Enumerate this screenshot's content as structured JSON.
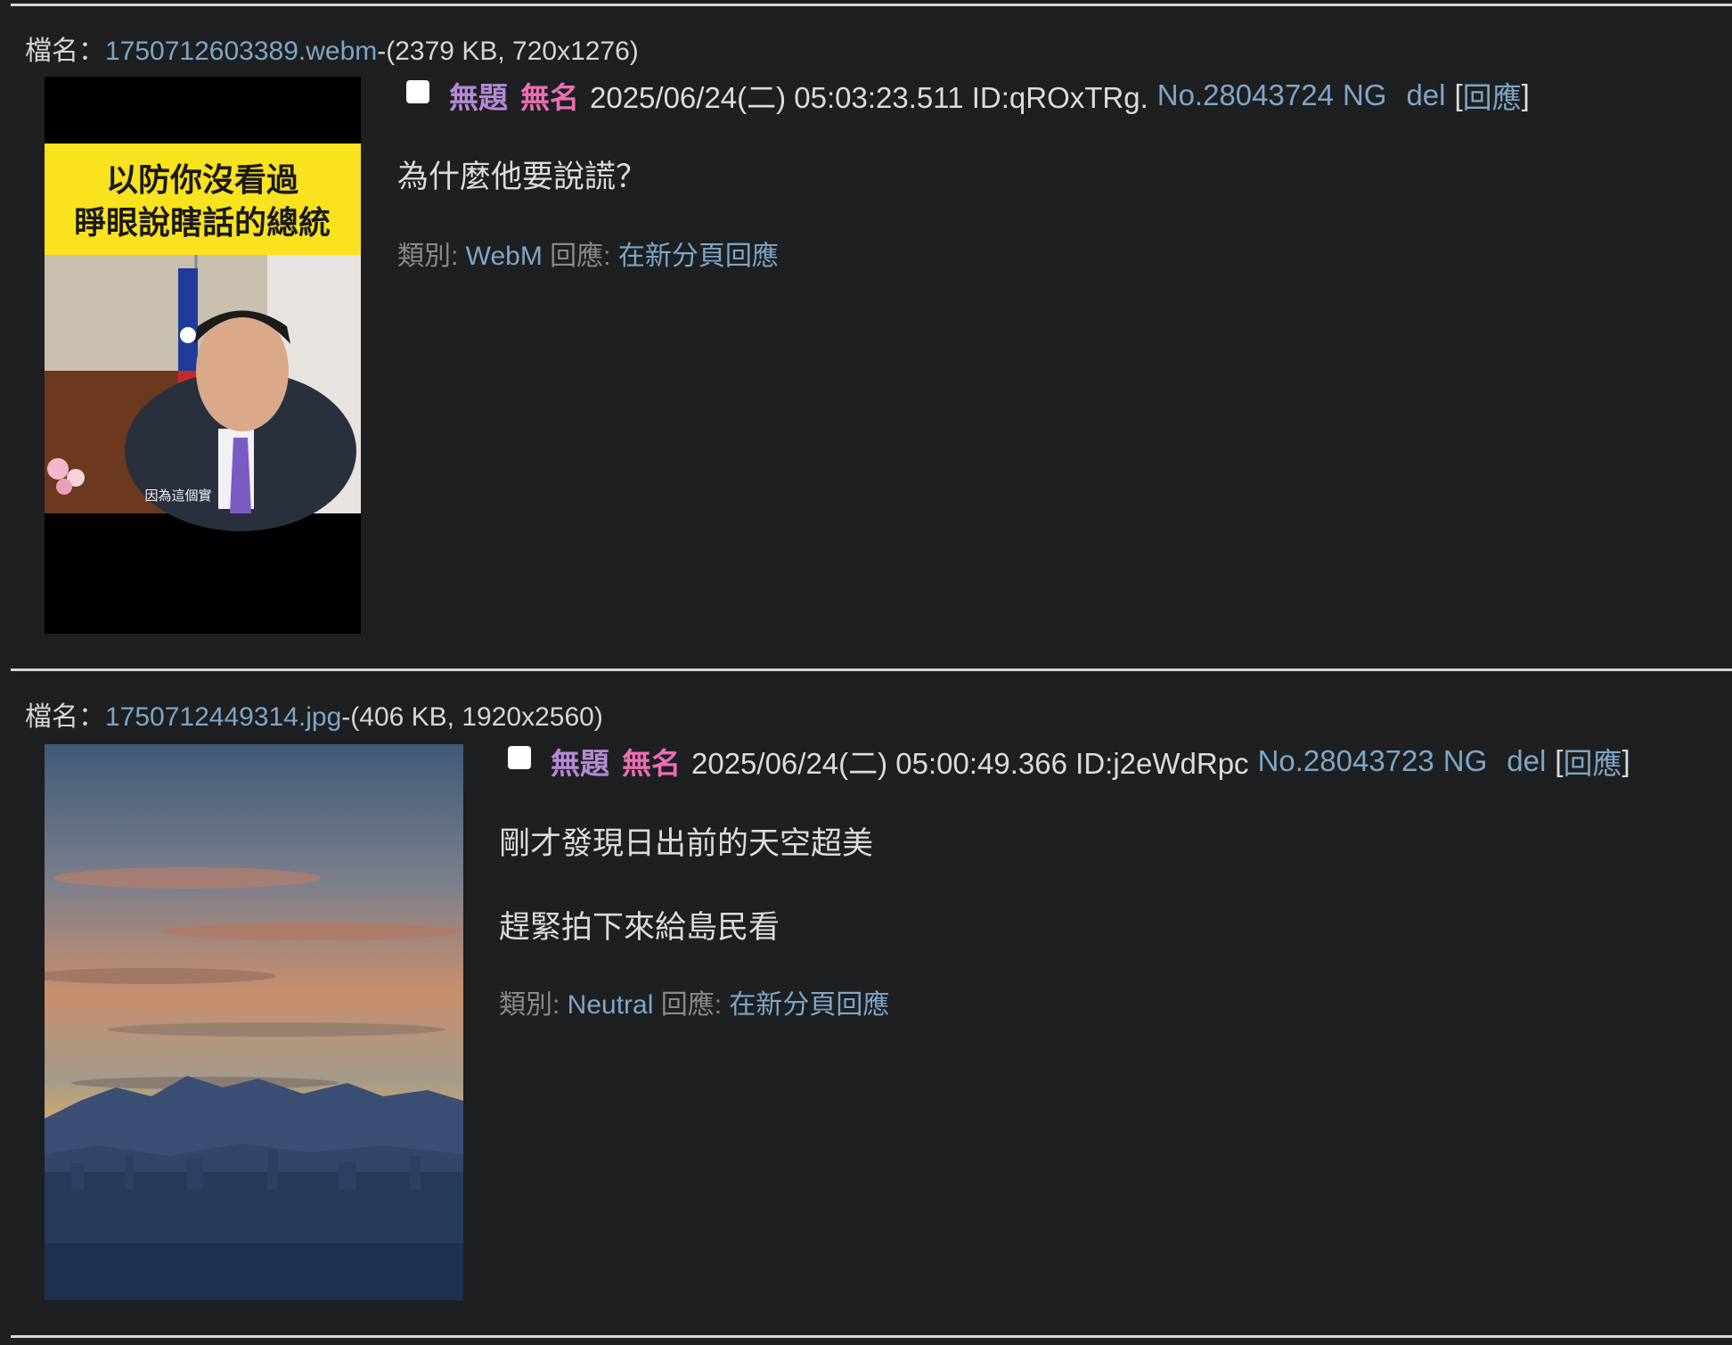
{
  "posts": [
    {
      "file_label": "檔名：",
      "file_name": "1750712603389.webm",
      "file_info": "-(2379 KB, 720x1276)",
      "title": "無題",
      "name": "無名",
      "datetime": "2025/06/24(二) 05:03:23.511 ID:qROxTRg.",
      "number": "No.28043724",
      "ng": "NG",
      "del": "del",
      "bracket_open": "[",
      "reply": "回應",
      "bracket_close": "]",
      "body": [
        "為什麼他要說謊？"
      ],
      "category_label": "類別: ",
      "category": "WebM",
      "reply_label": " 回應: ",
      "reply_new_tab": "在新分頁回應",
      "thumb": {
        "caption_line1": "以防你沒看過",
        "caption_line2": "睜眼說瞎話的總統",
        "subtitle": "因為這個實",
        "banner_color": "#f9e21e"
      }
    },
    {
      "file_label": "檔名：",
      "file_name": "1750712449314.jpg",
      "file_info": "-(406 KB, 1920x2560)",
      "title": "無題",
      "name": "無名",
      "datetime": "2025/06/24(二) 05:00:49.366 ID:j2eWdRpc",
      "number": "No.28043723",
      "ng": "NG",
      "del": "del",
      "bracket_open": "[",
      "reply": "回應",
      "bracket_close": "]",
      "body": [
        "剛才發現日出前的天空超美",
        "趕緊拍下來給島民看"
      ],
      "category_label": "類別: ",
      "category": "Neutral",
      "reply_label": " 回應: ",
      "reply_new_tab": "在新分頁回應"
    }
  ],
  "colors": {
    "background": "#1e1f21",
    "link": "#7fa6c6",
    "title": "#b48ad6",
    "name": "#ea6fb4"
  }
}
